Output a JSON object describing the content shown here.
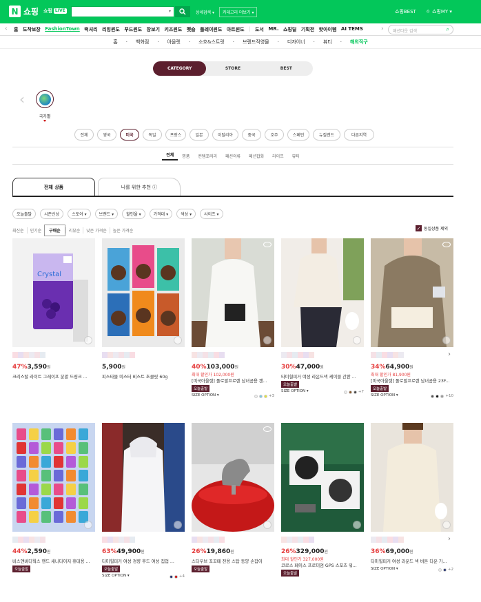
{
  "header": {
    "logo_n": "N",
    "logo_text": "쇼핑",
    "live_text": "쇼핑",
    "live_badge": "LIVE",
    "advanced": "상세검색 ▾",
    "category_select": "카테고리 더보기 ▾",
    "best": "쇼핑BEST",
    "my": "쇼핑MY ▾"
  },
  "nav1": {
    "items": [
      "홈",
      "도착보장",
      "FashionTown",
      "럭셔리",
      "리빙윈도",
      "푸드윈도",
      "장보기",
      "키즈윈도",
      "펫숍",
      "플레이윈도",
      "아트윈도",
      "|",
      "도서",
      "MR.",
      "쇼핑딜",
      "기획전",
      "핫아이템",
      "AI TEMS"
    ],
    "search_placeholder": "패션타운 검색"
  },
  "nav2": {
    "items": [
      "홈",
      "백화점",
      "아울렛",
      "소호&스트릿",
      "브랜드직영몰",
      "디자이너",
      "뷰티",
      "해외직구"
    ]
  },
  "view_tabs": [
    "CATEGORY",
    "STORE",
    "BEST"
  ],
  "country_label": "국가별",
  "countries": [
    "전체",
    "영국",
    "미국",
    "독일",
    "프랑스",
    "일본",
    "이탈리아",
    "중국",
    "호주",
    "스페인",
    "뉴질랜드",
    "다른지역"
  ],
  "subtabs": [
    "전체",
    "명품",
    "컨템포러리",
    "패션의류",
    "패션잡화",
    "라이프",
    "뷰티"
  ],
  "main_tabs": [
    "전체 상품",
    "나를 위한 추천 ⓘ"
  ],
  "filters": [
    "오늘출발",
    "시즌신상",
    "스토어 ▾",
    "브랜드 ▾",
    "할인율 ▾",
    "가격대 ▾",
    "색상 ▾",
    "사이즈 ▾"
  ],
  "sorts": [
    "최신순",
    "인기순",
    "구매순",
    "리뷰순",
    "낮은 가격순",
    "높은 가격순"
  ],
  "exclude_label": "동일상품 제외",
  "size_option_label": "SIZE OPTION ▾",
  "today_badge": "오늘출발",
  "products": [
    {
      "pct": "47%",
      "price": "3,590",
      "won": "원",
      "was": "",
      "name": "크리스탈 라이트 그레이프 분말 드링크 ...",
      "badge": false,
      "size": false,
      "swatches": [],
      "more": ""
    },
    {
      "pct": "",
      "price": "5,900",
      "won": "원",
      "was": "",
      "name": "피스타물 미스터 비스트 초콜릿 60g",
      "badge": false,
      "size": false,
      "swatches": [],
      "more": ""
    },
    {
      "pct": "40%",
      "price": "103,000",
      "won": "원",
      "was_label": "최대 할인가",
      "was": "102,000원",
      "name": "[미국아울렛] 폴로랄프로렌 남녀공용 캔...",
      "badge": true,
      "size": true,
      "swatches": [
        "#eee",
        "#7ec8e3",
        "#e5e533"
      ],
      "more": "+3"
    },
    {
      "pct": "30%",
      "price": "47,000",
      "won": "원",
      "was": "",
      "name": "타미힐피거 여성 라운드넥 케이블 간판 ...",
      "badge": true,
      "size": true,
      "swatches": [
        "#eee",
        "#8b5a2b",
        "#444"
      ],
      "more": "+7"
    },
    {
      "pct": "34%",
      "price": "64,900",
      "won": "원",
      "was_label": "최대 할인가",
      "was": "81,900원",
      "name": "[미국아울렛] 폴로랄프로렌 남녀공용 23F...",
      "badge": true,
      "size": true,
      "swatches": [
        "#555",
        "#111",
        "#999"
      ],
      "more": "+10"
    },
    {
      "pct": "44%",
      "price": "2,590",
      "won": "원",
      "was": "",
      "name": "비스앤바디웍스 핸드 새니타이저 휴대용 ...",
      "badge": true,
      "size": false,
      "swatches": [],
      "more": ""
    },
    {
      "pct": "63%",
      "price": "49,900",
      "won": "원",
      "was": "",
      "name": "타미힐피거 여성 경량 후드 여성 집업 ...",
      "badge": true,
      "size": true,
      "swatches": [
        "#1b2a6b",
        "#c00"
      ],
      "more": "+4"
    },
    {
      "pct": "26%",
      "price": "19,860",
      "won": "원",
      "was": "",
      "name": "스타우브 꼬꼬떼 전용 스탑 동양 손잡이",
      "badge": true,
      "size": false,
      "swatches": [],
      "more": ""
    },
    {
      "pct": "26%",
      "price": "329,000",
      "won": "원",
      "was_label": "최대 할인가",
      "was": "327,000원",
      "name": "코로스 페이스 프로미엄 GPS 스포츠 워...",
      "badge": true,
      "size": false,
      "swatches": [],
      "more": ""
    },
    {
      "pct": "36%",
      "price": "69,000",
      "won": "원",
      "was": "",
      "name": "타미힐피거 여성 라운드 넥 버튼 다운 가...",
      "badge": false,
      "size": true,
      "swatches": [
        "#eee",
        "#1b2a6b"
      ],
      "more": "+2"
    }
  ]
}
